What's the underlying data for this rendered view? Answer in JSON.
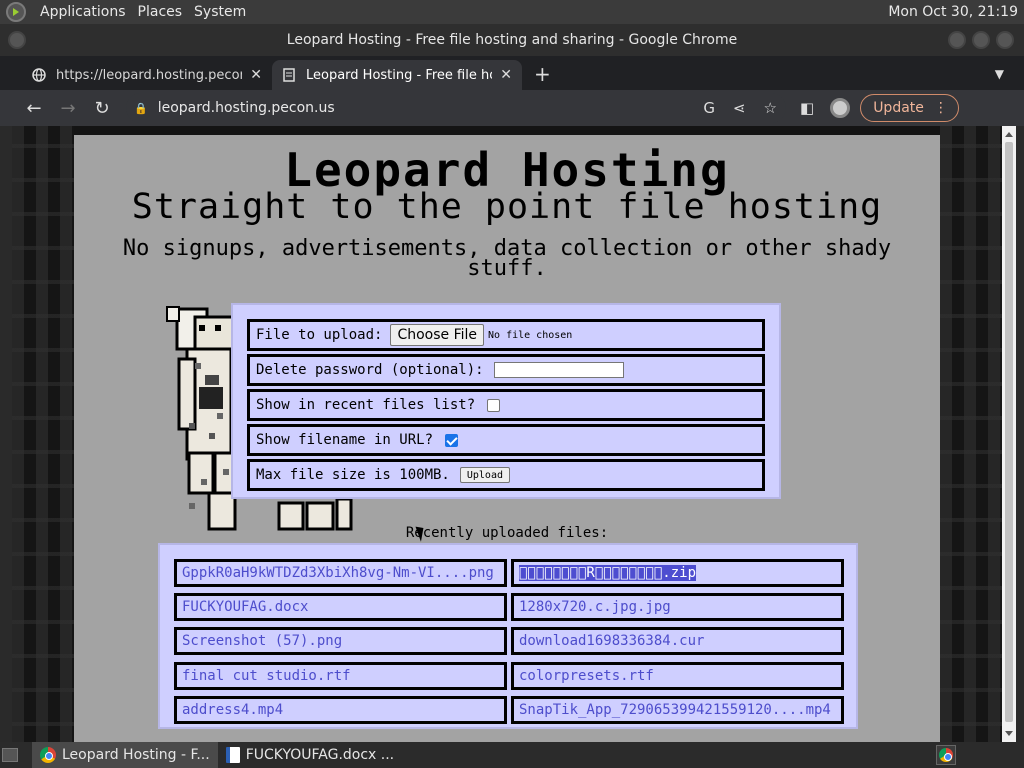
{
  "panel": {
    "menus": [
      "Applications",
      "Places",
      "System"
    ],
    "clock": "Mon Oct 30, 21:19"
  },
  "window": {
    "title": "Leopard Hosting - Free file hosting and sharing - Google Chrome"
  },
  "tabs": [
    {
      "label": "https://leopard.hosting.pecon.u",
      "favicon": "globe-icon",
      "active": false
    },
    {
      "label": "Leopard Hosting - Free file hos",
      "favicon": "page-icon",
      "active": true
    }
  ],
  "omnibox": {
    "url": "leopard.hosting.pecon.us"
  },
  "toolbar": {
    "update_label": "Update"
  },
  "page": {
    "title": "Leopard Hosting",
    "subtitle": "Straight to the point file hosting",
    "tagline": "No signups, advertisements, data collection or other shady stuff.",
    "form": {
      "file_label": "File to upload:",
      "choose_label": "Choose File",
      "no_file": "No file chosen",
      "password_label": "Delete password (optional):",
      "password_value": "",
      "recent_label": "Show in recent files list?",
      "recent_checked": false,
      "filename_label": "Show filename in URL?",
      "filename_checked": true,
      "maxsize_label": "Max file size is 100MB.",
      "upload_label": "Upload"
    },
    "recent_heading": "Recently uploaded files:",
    "recent_files": [
      "GppkR0aH9kWTDZd3XbiXh8vg-Nm-VI....png",
      "\u0000\u0000\u0000\u0000\u0000\u0000\u0000\u0000R\u0000\u0000\u0000\u0000\u0000\u0000\u0000\u0000.zip",
      "FUCKYOUFAG.docx",
      "1280x720.c.jpg.jpg",
      "Screenshot (57).png",
      "download1698336384.cur",
      "final cut studio.rtf",
      "colorpresets.rtf",
      "address4.mp4",
      "SnapTik_App_729065399421559120....mp4"
    ]
  },
  "taskbar": {
    "items": [
      {
        "label": "Leopard Hosting - F...",
        "icon": "chrome-icon",
        "active": true
      },
      {
        "label": "FUCKYOUFAG.docx ...",
        "icon": "document-icon",
        "active": false
      }
    ]
  },
  "colors": {
    "page_bg": "#a3a3a3",
    "box_bg": "#cfcfff",
    "link": "#4d4dcc",
    "update_accent": "#f0b59a"
  }
}
